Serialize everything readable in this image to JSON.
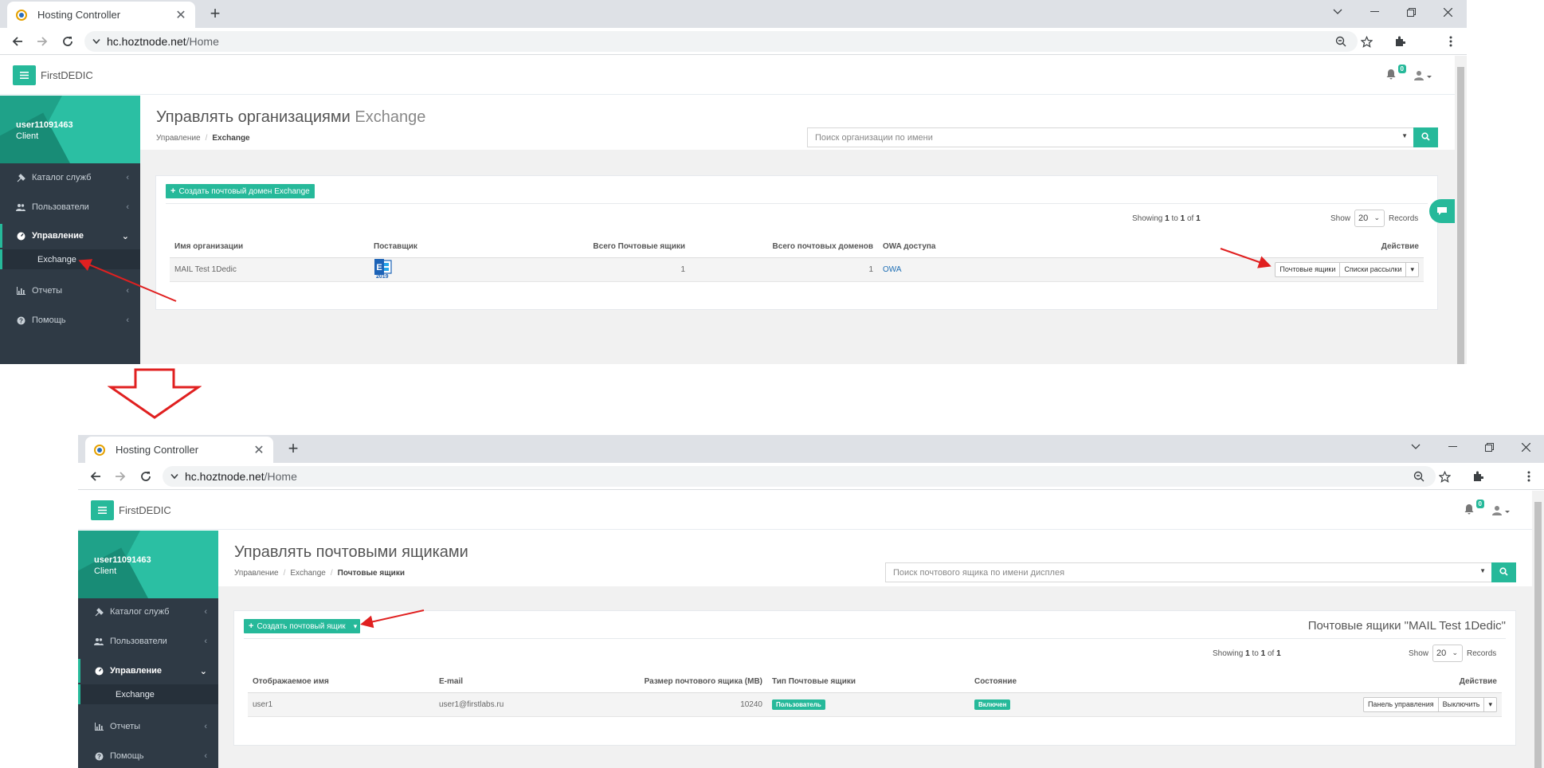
{
  "colors": {
    "accent": "#26b99a",
    "sidebar": "#2f3a45",
    "arrow": "#e02020"
  },
  "screens": [
    {
      "browser": {
        "tab_title": "Hosting Controller",
        "url_host": "hc.hoztnode.net",
        "url_path": "/Home"
      },
      "header": {
        "brand": "FirstDEDIC",
        "notifications": "0"
      },
      "profile": {
        "username": "user11091463",
        "role": "Client"
      },
      "sidebar": {
        "items": [
          {
            "label": "Каталог служб",
            "icon": "gavel-icon"
          },
          {
            "label": "Пользователи",
            "icon": "users-icon"
          },
          {
            "label": "Управление",
            "icon": "dashboard-icon"
          },
          {
            "label": "Exchange",
            "icon": ""
          },
          {
            "label": "Отчеты",
            "icon": "bar-chart-icon"
          },
          {
            "label": "Помощь",
            "icon": "help-icon"
          }
        ]
      },
      "page": {
        "title": "Управлять организациями",
        "title_suffix": "Exchange",
        "breadcrumb": [
          "Управление",
          "Exchange"
        ],
        "search_placeholder": "Поиск организации по имени"
      },
      "panel": {
        "create_button": "Создать почтовый домен Exchange",
        "showing_prefix": "Showing",
        "showing_from": "1",
        "showing_to_word": "to",
        "showing_to": "1",
        "showing_of_word": "of",
        "showing_total": "1",
        "show_label": "Show",
        "page_size": "20",
        "records_label": "Records",
        "columns": [
          "Имя организации",
          "Поставщик",
          "Всего Почтовые ящики",
          "Всего почтовых доменов",
          "OWA доступа",
          "Действие"
        ],
        "row": {
          "name": "MAIL Test 1Dedic",
          "provider_year": "2019",
          "mailboxes": "1",
          "domains": "1",
          "owa": "OWA",
          "action_1": "Почтовые ящики",
          "action_2": "Списки рассылки"
        }
      }
    },
    {
      "browser": {
        "tab_title": "Hosting Controller",
        "url_host": "hc.hoztnode.net",
        "url_path": "/Home"
      },
      "header": {
        "brand": "FirstDEDIC",
        "notifications": "0"
      },
      "profile": {
        "username": "user11091463",
        "role": "Client"
      },
      "sidebar": {
        "items": [
          {
            "label": "Каталог служб",
            "icon": "gavel-icon"
          },
          {
            "label": "Пользователи",
            "icon": "users-icon"
          },
          {
            "label": "Управление",
            "icon": "dashboard-icon"
          },
          {
            "label": "Exchange",
            "icon": ""
          },
          {
            "label": "Отчеты",
            "icon": "bar-chart-icon"
          },
          {
            "label": "Помощь",
            "icon": "help-icon"
          }
        ]
      },
      "page": {
        "title": "Управлять почтовыми ящиками",
        "breadcrumb": [
          "Управление",
          "Exchange",
          "Почтовые ящики"
        ],
        "search_placeholder": "Поиск почтового ящика по имени дисплея"
      },
      "panel": {
        "create_button": "Создать почтовый ящик",
        "panel_title": "Почтовые ящики \"MAIL Test 1Dedic\"",
        "showing_prefix": "Showing",
        "showing_from": "1",
        "showing_to_word": "to",
        "showing_to": "1",
        "showing_of_word": "of",
        "showing_total": "1",
        "show_label": "Show",
        "page_size": "20",
        "records_label": "Records",
        "columns": [
          "Отображаемое имя",
          "E-mail",
          "Размер почтового ящика (MB)",
          "Тип Почтовые ящики",
          "Состояние",
          "Действие"
        ],
        "row": {
          "display_name": "user1",
          "email": "user1@firstlabs.ru",
          "size": "10240",
          "type": "Пользователь",
          "state": "Включен",
          "action_1": "Панель управления",
          "action_2": "Выключить"
        }
      }
    }
  ]
}
